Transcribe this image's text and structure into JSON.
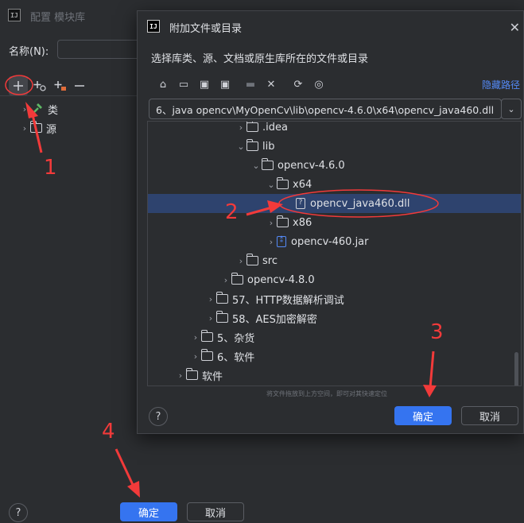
{
  "back_dialog": {
    "title": "配置 模块库",
    "logo_text": "IJ",
    "name_label": "名称(N):",
    "toolbar_icons": [
      "plus-icon",
      "add-with-badge-icon",
      "add-alt-icon",
      "minus-icon"
    ],
    "tree": [
      {
        "label": "类",
        "icon": "hammer-icon"
      },
      {
        "label": "源",
        "icon": "folder-icon"
      }
    ],
    "ok": "确定",
    "cancel": "取消",
    "help": "?"
  },
  "dialog": {
    "logo_text": "IJ",
    "title": "附加文件或目录",
    "description": "选择库类、源、文档或原生库所在的文件或目录",
    "hide_path": "隐藏路径",
    "path": "6、java opencv\\MyOpenCv\\lib\\opencv-4.6.0\\x64\\opencv_java460.dll",
    "tree": [
      {
        "label": ".idea",
        "type": "folder",
        "expanded": false
      },
      {
        "label": "lib",
        "type": "folder",
        "expanded": true
      },
      {
        "label": "opencv-4.6.0",
        "type": "folder",
        "expanded": true
      },
      {
        "label": "x64",
        "type": "folder",
        "expanded": true
      },
      {
        "label": "opencv_java460.dll",
        "type": "file",
        "selected": true
      },
      {
        "label": "x86",
        "type": "folder",
        "expanded": false
      },
      {
        "label": "opencv-460.jar",
        "type": "jar",
        "expanded": false
      },
      {
        "label": "src",
        "type": "folder",
        "expanded": false
      },
      {
        "label": "opencv-4.8.0",
        "type": "folder",
        "expanded": false
      },
      {
        "label": "57、HTTP数据解析调试",
        "type": "folder",
        "expanded": false
      },
      {
        "label": "58、AES加密解密",
        "type": "folder",
        "expanded": false
      },
      {
        "label": "5、杂货",
        "type": "folder",
        "expanded": false
      },
      {
        "label": "6、软件",
        "type": "folder",
        "expanded": false
      },
      {
        "label": "软件",
        "type": "folder",
        "expanded": false
      }
    ],
    "drop_hint": "将文件拖放到上方空间，即可对其快速定位",
    "ok": "确定",
    "cancel": "取消",
    "help": "?"
  },
  "annotations": [
    "1",
    "2",
    "3",
    "4"
  ],
  "colors": {
    "accent": "#3574f0",
    "annotation": "#f23a3a",
    "selection": "#2e436e"
  }
}
